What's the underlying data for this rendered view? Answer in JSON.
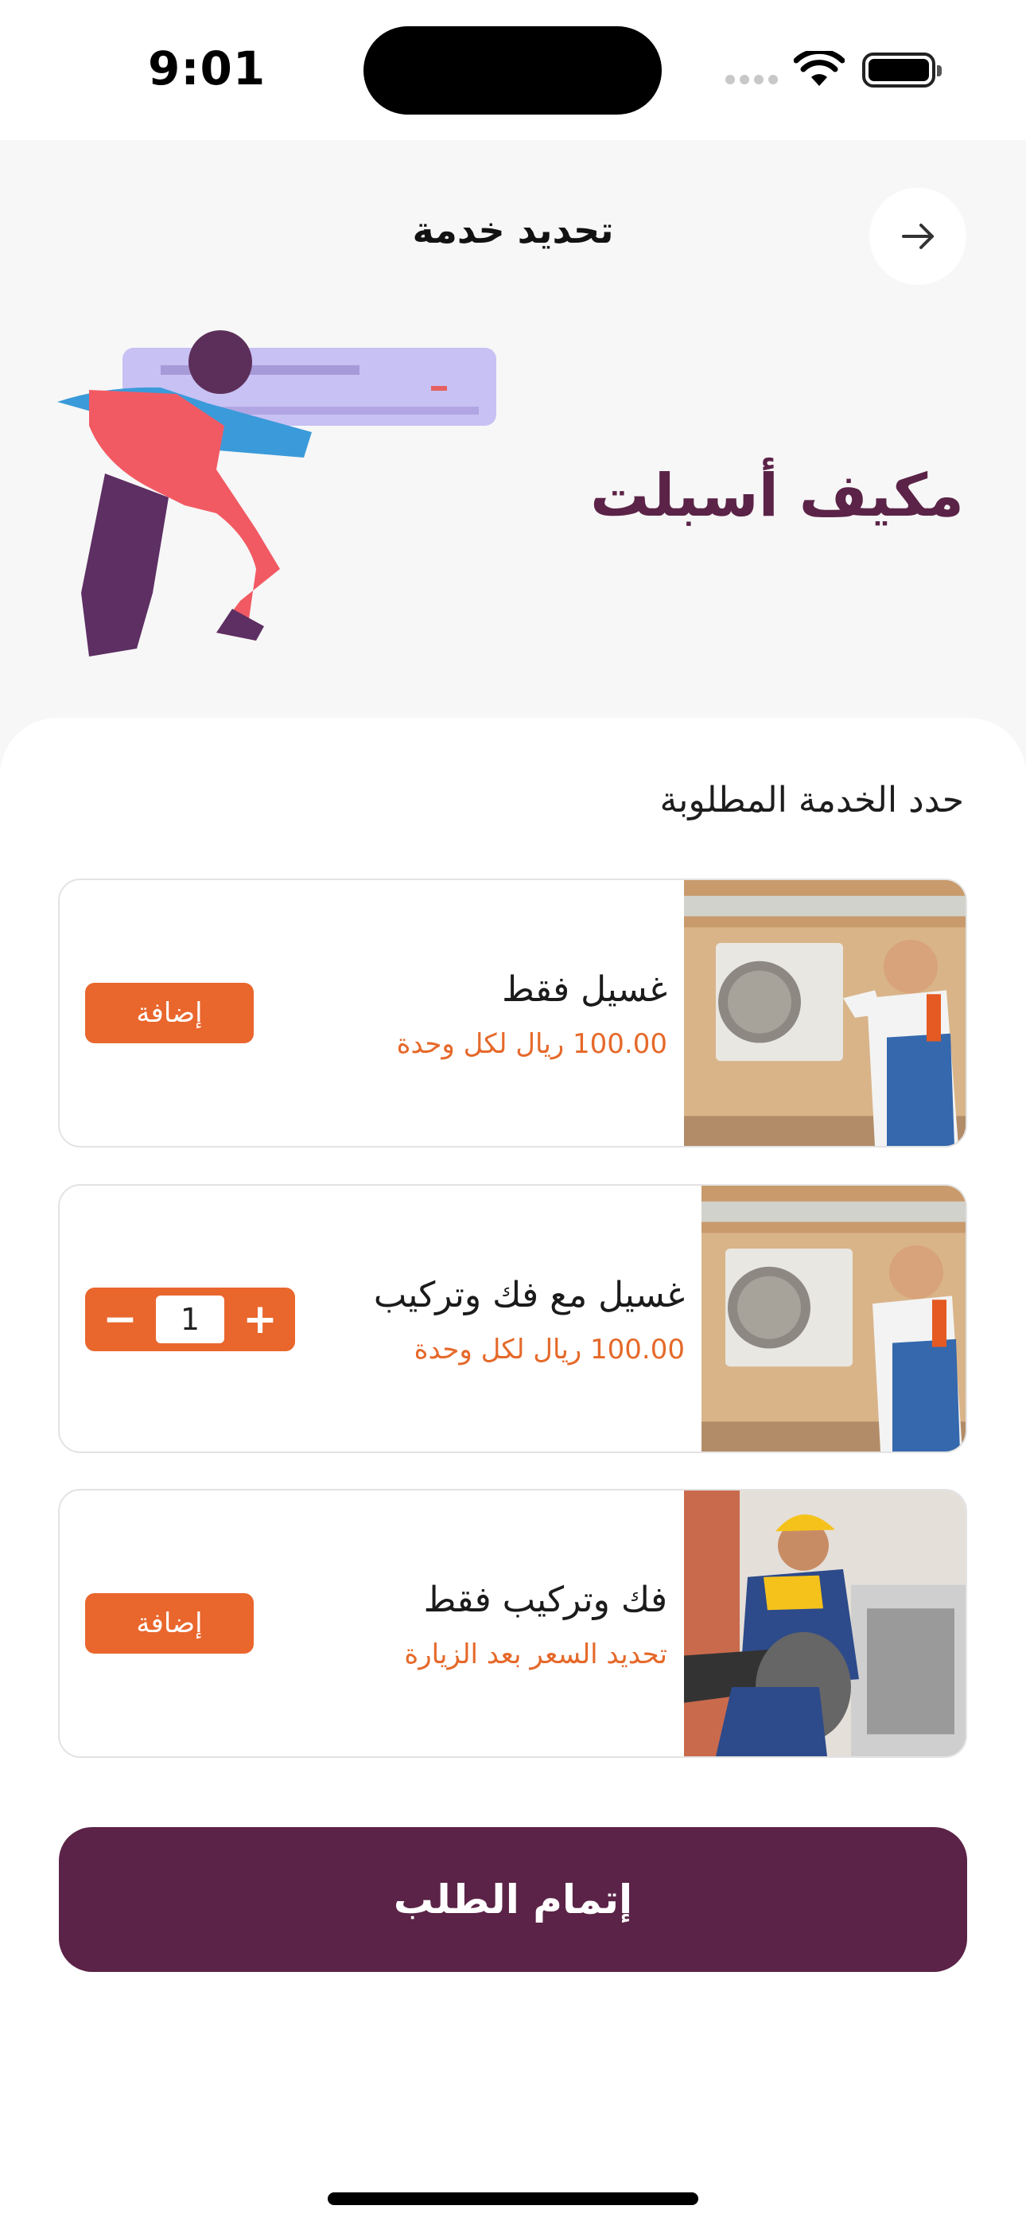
{
  "status_bar": {
    "time": "9:01"
  },
  "header": {
    "title": "تحديد خدمة",
    "back_icon": "arrow-right-icon"
  },
  "category": {
    "title": "مكيف أسبلت"
  },
  "section": {
    "title": "حدد الخدمة المطلوبة"
  },
  "services": [
    {
      "name": "غسيل فقط",
      "price": "100.00 ريال لكل وحدة",
      "action": "إضافة"
    },
    {
      "name": "غسيل مع فك وتركيب",
      "price": "100.00 ريال لكل وحدة",
      "quantity": "1",
      "minus": "−",
      "plus": "+"
    },
    {
      "name": "فك وتركيب فقط",
      "price": "تحديد السعر بعد الزيارة",
      "action": "إضافة"
    }
  ],
  "footer": {
    "submit_label": "إتمام الطلب"
  },
  "colors": {
    "primary": "#5b2347",
    "accent": "#e9662d"
  }
}
